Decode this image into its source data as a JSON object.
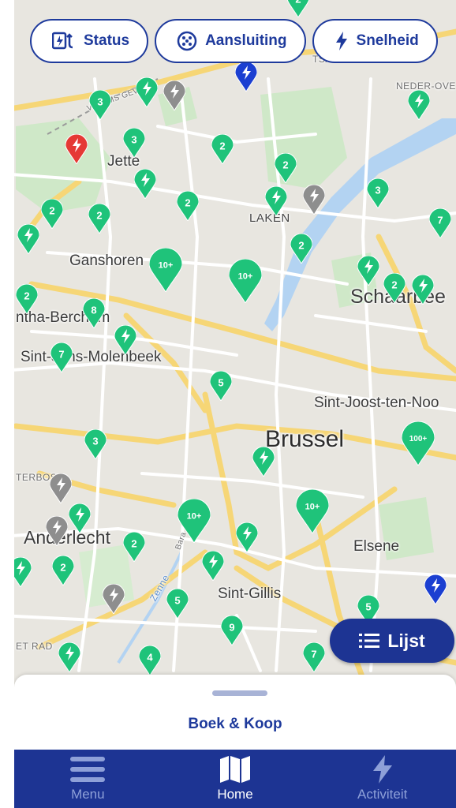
{
  "filters": [
    {
      "label": "Status",
      "icon": "status-icon"
    },
    {
      "label": "Aansluiting",
      "icon": "connector-icon"
    },
    {
      "label": "Snelheid",
      "icon": "lightning-icon"
    }
  ],
  "map": {
    "places": [
      {
        "id": "jette",
        "text": "Jette"
      },
      {
        "id": "laken",
        "text": "LAKEN"
      },
      {
        "id": "ganshoren",
        "text": "Ganshoren"
      },
      {
        "id": "schaarbeek",
        "text": "Schaarbee"
      },
      {
        "id": "berchem",
        "text": "ntha-Berchem"
      },
      {
        "id": "molenbeek",
        "text": "Sint-Jans-Molenbeek"
      },
      {
        "id": "sintjoost",
        "text": "Sint-Joost-ten-Noo"
      },
      {
        "id": "brussel",
        "text": "Brussel"
      },
      {
        "id": "terbos",
        "text": "TERBOS"
      },
      {
        "id": "anderlecht",
        "text": "Anderlecht"
      },
      {
        "id": "elsene",
        "text": "Elsene"
      },
      {
        "id": "sintgillis",
        "text": "Sint-Gillis"
      },
      {
        "id": "nederover",
        "text": "NEDER-OVE"
      },
      {
        "id": "vlaams",
        "text": "VLAAMS GEWES"
      },
      {
        "id": "etrad",
        "text": "ET RAD"
      },
      {
        "id": "zenne",
        "text": "Zenne"
      },
      {
        "id": "bara",
        "text": "Bara"
      },
      {
        "id": "tsa",
        "text": "TSA"
      }
    ],
    "pins": [
      {
        "label": "2"
      },
      {
        "label": "3"
      },
      {
        "label": "3"
      },
      {
        "label": "2"
      },
      {
        "label": "2"
      },
      {
        "label": "2"
      },
      {
        "label": "2"
      },
      {
        "label": "2"
      },
      {
        "label": "3"
      },
      {
        "label": "7"
      },
      {
        "label": "10+"
      },
      {
        "label": "10+"
      },
      {
        "label": "2"
      },
      {
        "label": "2"
      },
      {
        "label": "8"
      },
      {
        "label": "7"
      },
      {
        "label": "5"
      },
      {
        "label": "3"
      },
      {
        "label": "100+"
      },
      {
        "label": "10+"
      },
      {
        "label": "10+"
      },
      {
        "label": "2"
      },
      {
        "label": "2"
      },
      {
        "label": "5"
      },
      {
        "label": "9"
      },
      {
        "label": "4"
      },
      {
        "label": "7"
      },
      {
        "label": "5"
      },
      {
        "label": "2"
      }
    ],
    "colors": {
      "available": "#1fc37a",
      "offline": "#8e8e8e",
      "occupied": "#e53935",
      "fast": "#1b3fd1"
    }
  },
  "list_button": {
    "label": "Lijst",
    "icon": "list-icon"
  },
  "sheet": {
    "title": "Boek & Koop"
  },
  "nav": [
    {
      "label": "Menu",
      "icon": "menu-icon"
    },
    {
      "label": "Home",
      "icon": "map-icon"
    },
    {
      "label": "Activiteit",
      "icon": "activity-icon"
    }
  ]
}
